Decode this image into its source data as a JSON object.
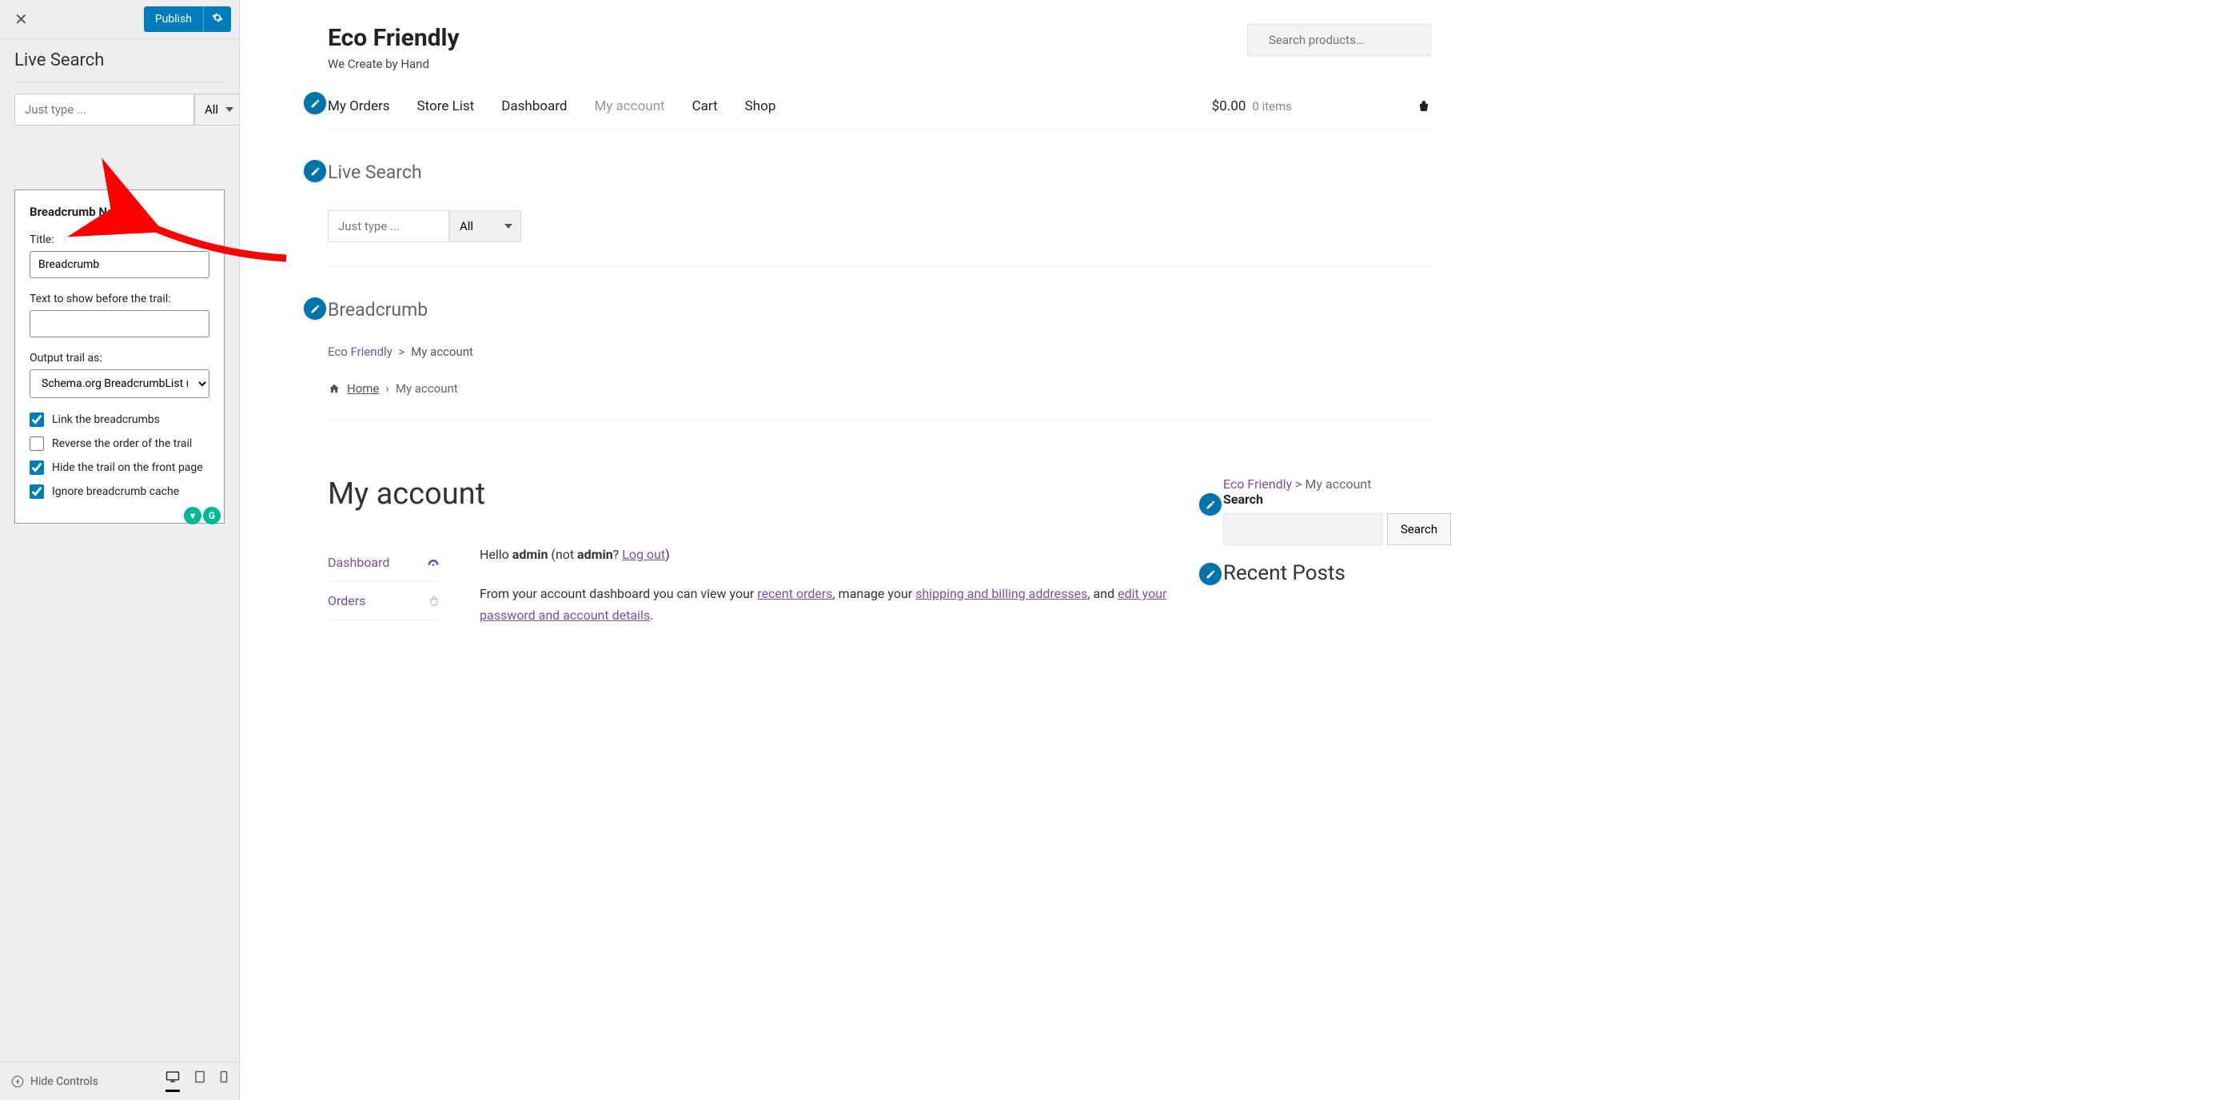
{
  "sidebar": {
    "publish_label": "Publish",
    "section_title": "Live Search",
    "search_placeholder": "Just type ...",
    "filter_option": "All",
    "widget": {
      "heading": "Breadcrumb NavXT",
      "title_label": "Title:",
      "title_value": "Breadcrumb",
      "before_label": "Text to show before the trail:",
      "before_value": "",
      "output_label": "Output trail as:",
      "output_value": "Schema.org BreadcrumbList (R",
      "cb_link": "Link the breadcrumbs",
      "cb_reverse": "Reverse the order of the trail",
      "cb_hide": "Hide the trail on the front page",
      "cb_ignore": "Ignore breadcrumb cache"
    },
    "footer": {
      "hide_controls": "Hide Controls"
    }
  },
  "preview": {
    "site_title": "Eco Friendly",
    "site_tagline": "We Create by Hand",
    "search_placeholder": "Search products…",
    "nav": [
      "My Orders",
      "Store List",
      "Dashboard",
      "My account",
      "Cart",
      "Shop"
    ],
    "cart_amount": "$0.00",
    "cart_items": "0 items",
    "live_search_heading": "Live Search",
    "live_search_placeholder": "Just type ...",
    "live_search_option": "All",
    "breadcrumb_heading": "Breadcrumb",
    "trail_home": "Eco Friendly",
    "trail_sep": ">",
    "trail_current": "My account",
    "home_link": "Home",
    "page_title": "My account",
    "account_nav": [
      "Dashboard",
      "Orders"
    ],
    "hello_prefix": "Hello ",
    "hello_user": "admin",
    "hello_not": " (not ",
    "hello_user2": "admin",
    "hello_q": "? ",
    "logout": "Log out",
    "hello_close": ")",
    "dashboard_text_1": "From your account dashboard you can view your ",
    "link_recent_orders": "recent orders",
    "dashboard_text_2": ", manage your ",
    "link_shipping_billing": "shipping and billing addresses",
    "dashboard_text_3": ", and ",
    "link_edit_account": "edit your password and account details",
    "dashboard_text_4": ".",
    "side": {
      "crumb_home": "Eco Friendly",
      "crumb_sep": ">",
      "crumb_current": "My account",
      "search_label": "Search",
      "search_button": "Search",
      "recent_posts": "Recent Posts"
    }
  }
}
